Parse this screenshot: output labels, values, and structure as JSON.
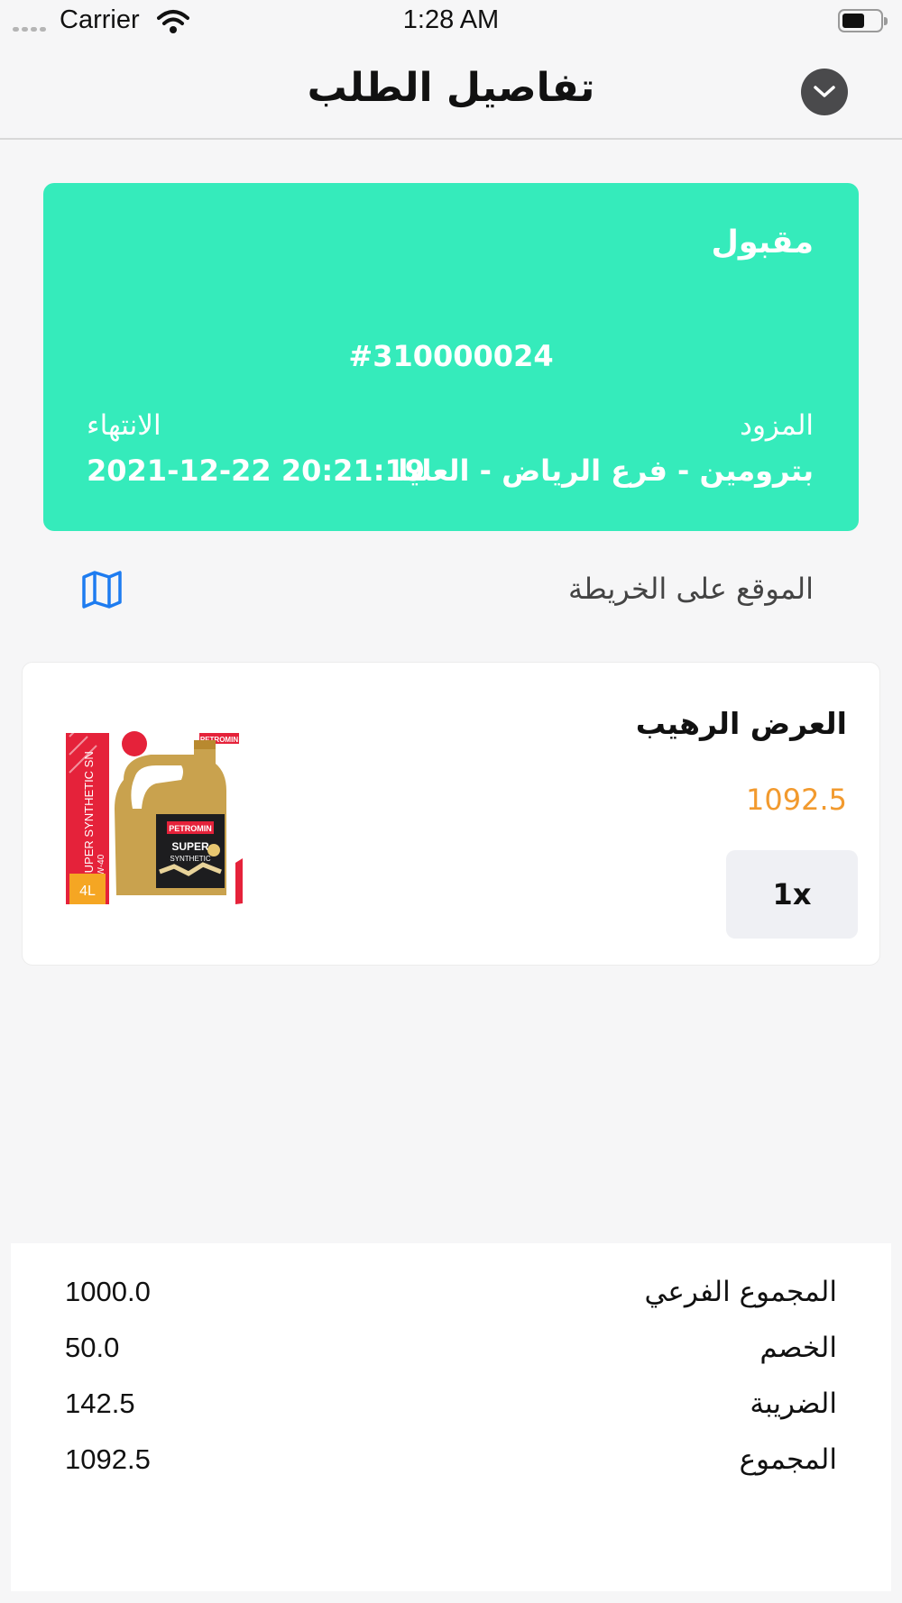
{
  "status_bar": {
    "carrier": "Carrier",
    "time": "1:28 AM"
  },
  "header": {
    "title": "تفاصيل الطلب",
    "close_icon": "chevron-down-icon"
  },
  "order": {
    "status": "مقبول",
    "number": "#310000024",
    "provider_label": "المزود",
    "provider_value": "بترومين - فرع الرياض - العليا",
    "expiry_label": "الانتهاء",
    "expiry_value": "2021-12-22 20:21:19"
  },
  "map": {
    "label": "الموقع على الخريطة",
    "icon": "map-icon"
  },
  "product": {
    "name": "العرض الرهيب",
    "price": "1092.5",
    "quantity": "1x",
    "image_text": {
      "line1": "SUPER SYNTHETIC SN",
      "line2": "5W-40",
      "size": "4L",
      "brand": "PETROMIN",
      "bottle_brand": "PETROMIN",
      "bottle_line1": "SUPER",
      "bottle_line2": "SYNTHETIC"
    }
  },
  "summary": {
    "rows": [
      {
        "label": "المجموع الفرعي",
        "value": "1000.0"
      },
      {
        "label": "الخصم",
        "value": "50.0"
      },
      {
        "label": "الضريبة",
        "value": "142.5"
      },
      {
        "label": "المجموع",
        "value": "1092.5"
      }
    ]
  },
  "colors": {
    "card_accent": "#35ebbb",
    "price": "#f29a2e",
    "map_icon": "#1e7cf0"
  }
}
